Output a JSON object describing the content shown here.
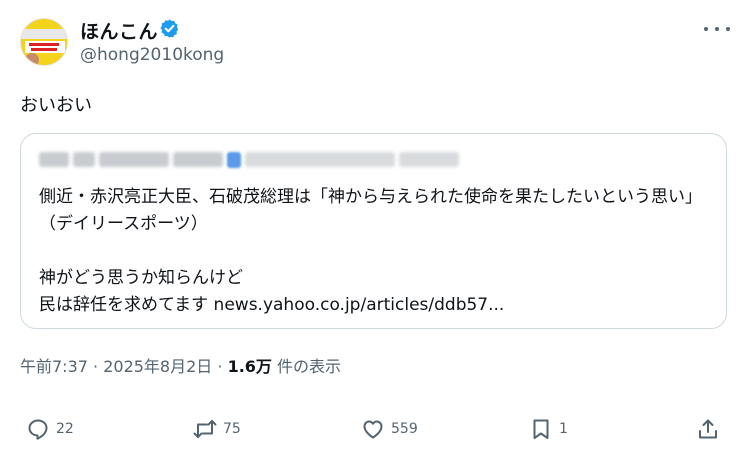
{
  "tweet": {
    "display_name": "ほんこん",
    "handle": "@hong2010kong",
    "text": "おいおい",
    "quote_text": "側近・赤沢亮正大臣、石破茂総理は「神から与えられた使命を果たしたいという思い」（デイリースポーツ）\n\n神がどう思うか知らんけど\n民は辞任を求めてます news.yahoo.co.jp/articles/ddb57...",
    "time": "午前7:37",
    "date": "2025年8月2日",
    "views_count": "1.6万",
    "views_label": "件の表示"
  },
  "actions": {
    "replies": "22",
    "reposts": "75",
    "likes": "559",
    "bookmarks": "1"
  },
  "icons": [
    "verified-badge-icon",
    "more-icon",
    "reply-icon",
    "repost-icon",
    "like-icon",
    "bookmark-icon",
    "share-icon"
  ],
  "colors": {
    "verified": "#1d9bf0",
    "muted": "#536471",
    "text": "#0f1419",
    "border": "#cfd9de"
  }
}
